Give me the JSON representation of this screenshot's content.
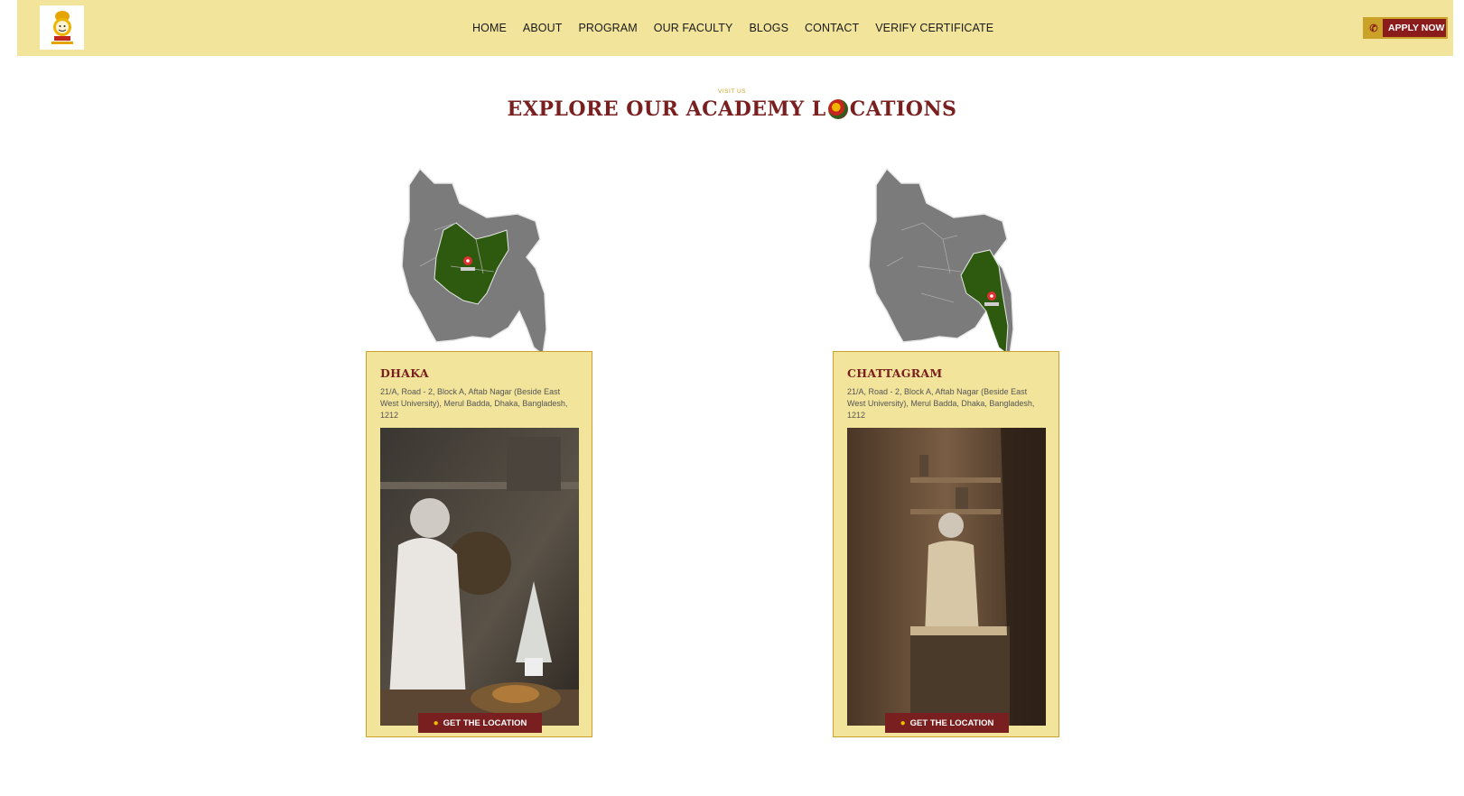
{
  "header": {
    "logo_text": "GOOD CHEF",
    "nav": [
      "HOME",
      "ABOUT",
      "PROGRAM",
      "OUR FACULTY",
      "BLOGS",
      "CONTACT",
      "VERIFY CERTIFICATE"
    ],
    "apply_label": "APPLY NOW",
    "colors": {
      "bar": "#f2e49b",
      "accent": "#8a1c1c",
      "gold": "#c9a227"
    }
  },
  "section": {
    "eyebrow": "VISIT US",
    "title_before": "EXPLORE OUR ACADEMY L",
    "title_after": "CATIONS"
  },
  "locations": [
    {
      "city": "DHAKA",
      "address": "21/A, Road - 2, Block A, Aftab Nagar (Beside East West University), Merul Badda, Dhaka, Bangladesh, 1212",
      "button": "GET THE LOCATION",
      "map_icon": "bangladesh-map-dhaka-icon"
    },
    {
      "city": "CHATTAGRAM",
      "address": "21/A, Road - 2, Block A, Aftab Nagar (Beside East West University), Merul Badda, Dhaka, Bangladesh, 1212",
      "button": "GET THE LOCATION",
      "map_icon": "bangladesh-map-chattagram-icon"
    }
  ]
}
